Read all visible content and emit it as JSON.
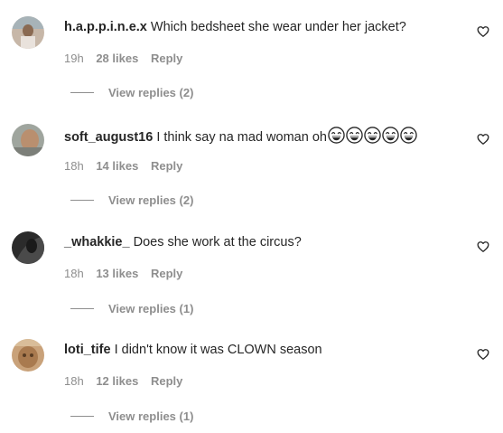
{
  "colors": {
    "primary_text": "#262626",
    "secondary_text": "#8e8e8e",
    "background": "#ffffff"
  },
  "comments": [
    {
      "username": "h.a.p.p.i.n.e.x",
      "text": "Which bedsheet she wear under her jacket?",
      "time": "19h",
      "likes": "28 likes",
      "reply": "Reply",
      "view_replies": "View replies (2)",
      "emoji_count": 0
    },
    {
      "username": "soft_august16",
      "text": "I think say na mad woman oh",
      "emojis": [
        "😂",
        "😂",
        "😂",
        "😂",
        "😂"
      ],
      "time": "18h",
      "likes": "14 likes",
      "reply": "Reply",
      "view_replies": "View replies (2)",
      "emoji_count": 5
    },
    {
      "username": "_whakkie_",
      "text": "Does she work at the circus?",
      "time": "18h",
      "likes": "13 likes",
      "reply": "Reply",
      "view_replies": "View replies (1)",
      "emoji_count": 0
    },
    {
      "username": "loti_tife",
      "text": "I didn't know it was CLOWN season",
      "time": "18h",
      "likes": "12 likes",
      "reply": "Reply",
      "view_replies": "View replies (1)",
      "emoji_count": 0
    }
  ],
  "icons": {
    "like": "heart-outline-icon",
    "emoji": "face-with-tears-of-joy-emoji"
  }
}
